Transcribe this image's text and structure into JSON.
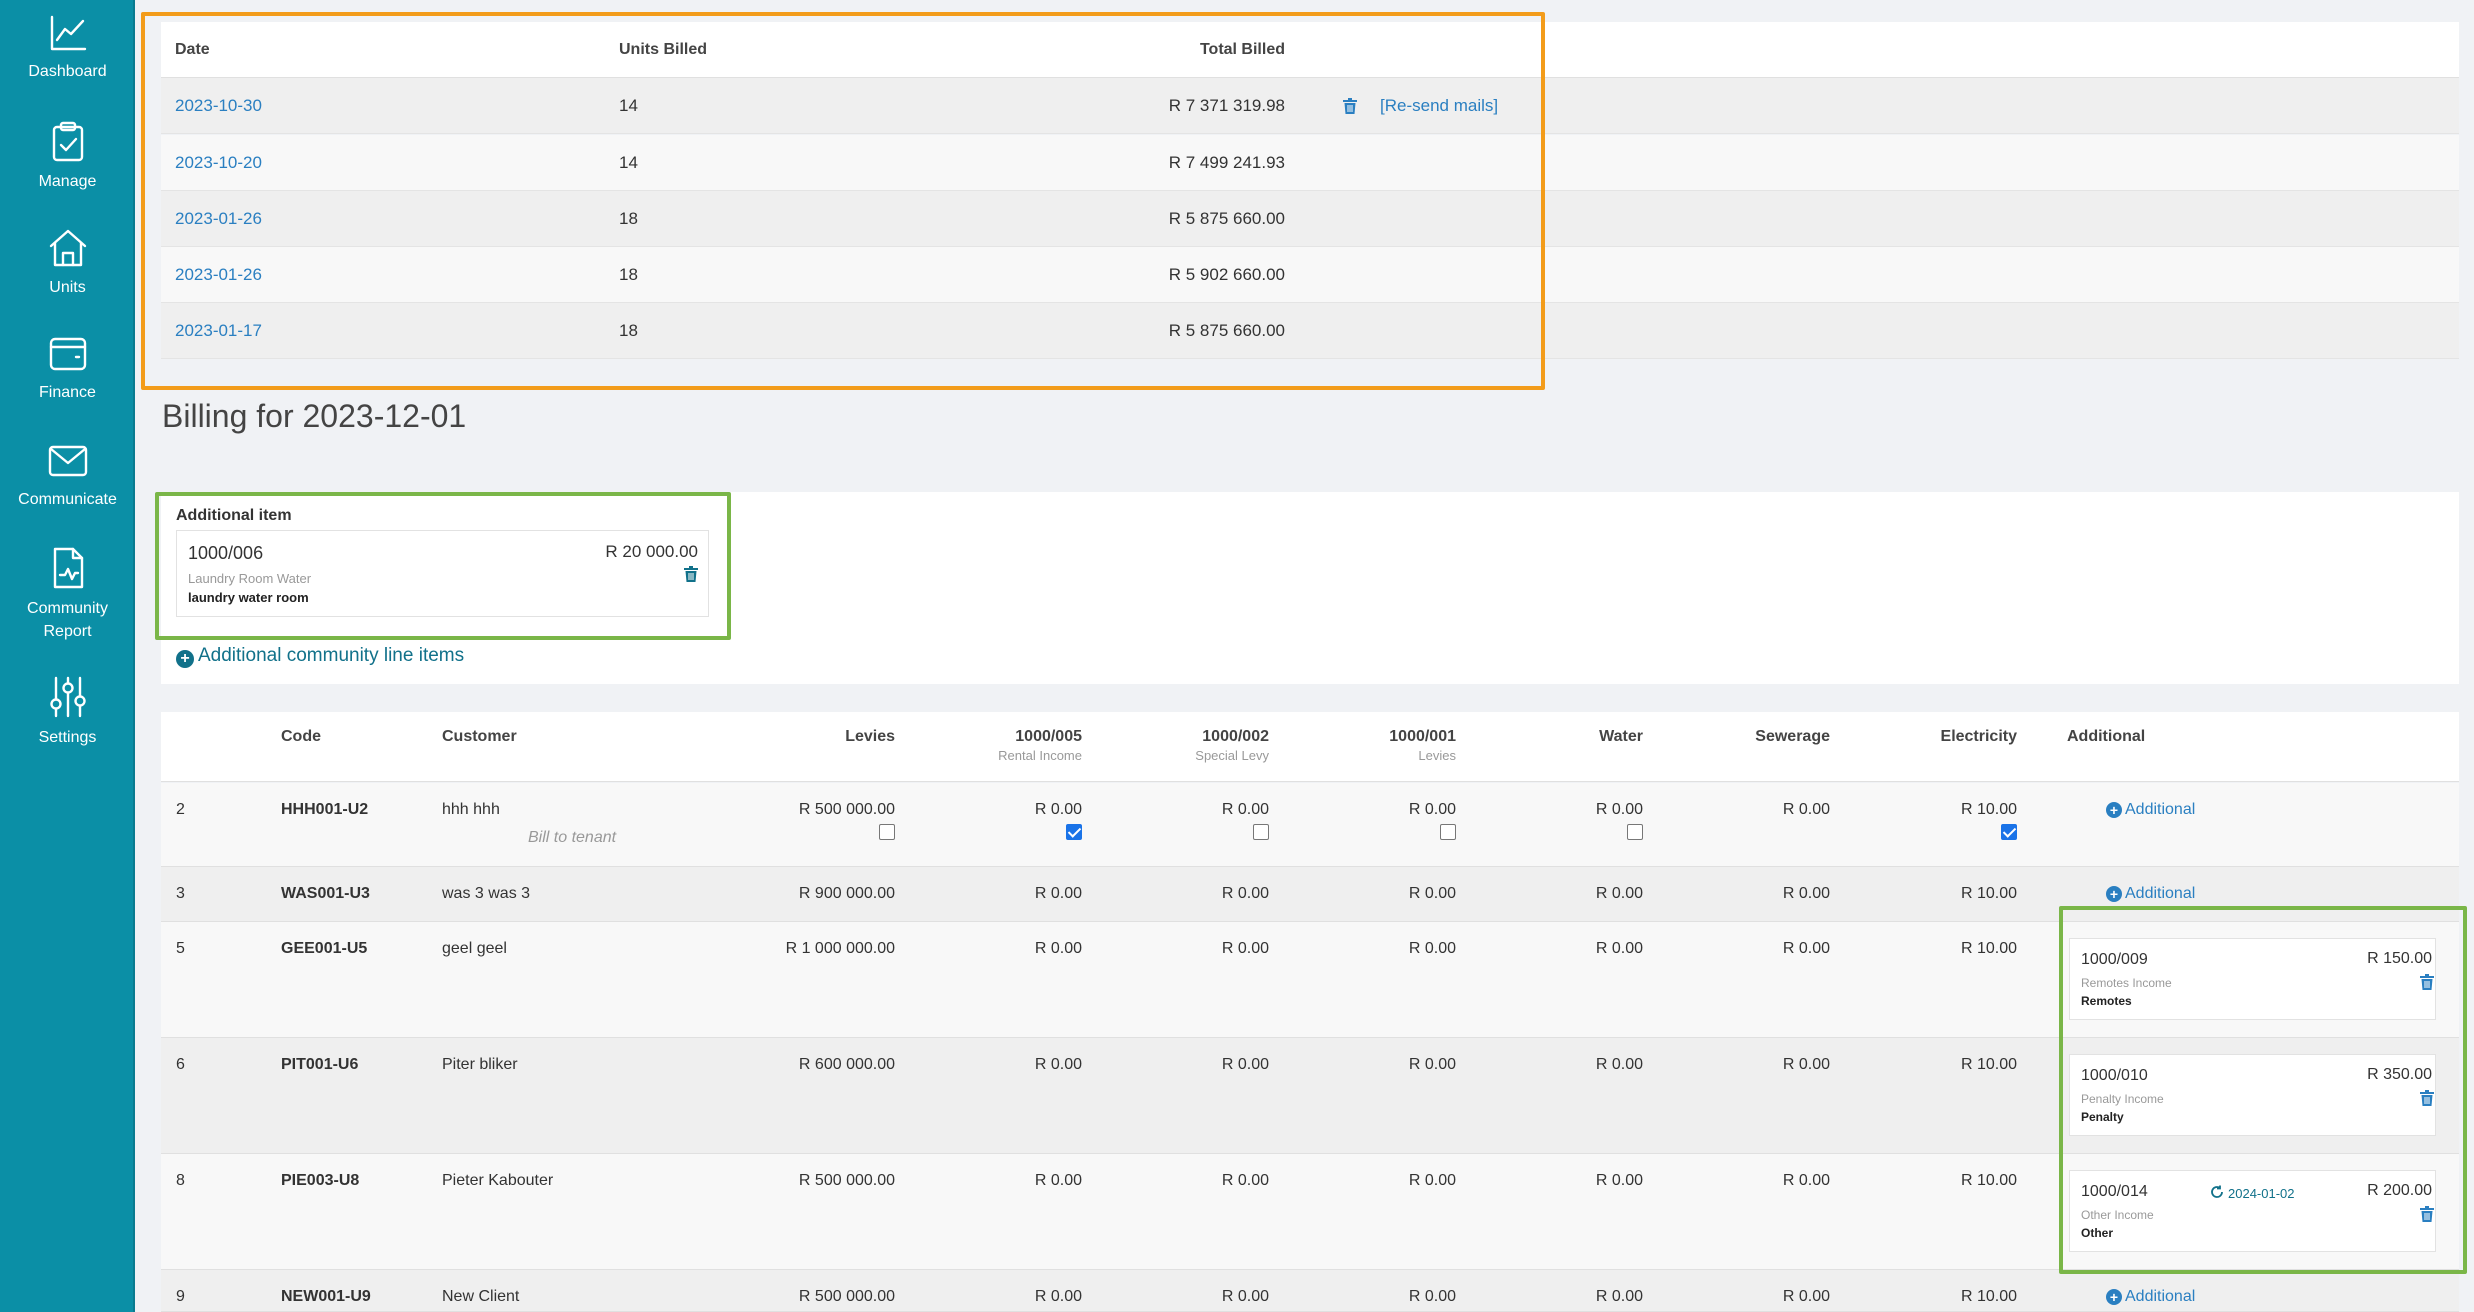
{
  "sidebar": {
    "items": [
      {
        "label": "Dashboard",
        "icon": "chart-line-icon"
      },
      {
        "label": "Manage",
        "icon": "clipboard-check-icon"
      },
      {
        "label": "Units",
        "icon": "home-icon"
      },
      {
        "label": "Finance",
        "icon": "wallet-icon"
      },
      {
        "label": "Communicate",
        "icon": "envelope-icon"
      },
      {
        "label": "Community Report",
        "icon": "report-icon"
      },
      {
        "label": "Settings",
        "icon": "sliders-icon"
      }
    ]
  },
  "history": {
    "headers": {
      "date": "Date",
      "units": "Units Billed",
      "total": "Total Billed"
    },
    "rows": [
      {
        "date": "2023-10-30",
        "units": "14",
        "total": "R 7 371 319.98",
        "resend": "[Re-send mails]"
      },
      {
        "date": "2023-10-20",
        "units": "14",
        "total": "R 7 499 241.93"
      },
      {
        "date": "2023-01-26",
        "units": "18",
        "total": "R 5 875 660.00"
      },
      {
        "date": "2023-01-26",
        "units": "18",
        "total": "R 5 902 660.00"
      },
      {
        "date": "2023-01-17",
        "units": "18",
        "total": "R 5 875 660.00"
      }
    ]
  },
  "billing": {
    "title": "Billing for 2023-12-01",
    "additional_item": {
      "heading": "Additional item",
      "code": "1000/006",
      "amount": "R 20 000.00",
      "account": "Laundry Room Water",
      "description": "laundry water room"
    },
    "add_community_link": "Additional community line items",
    "grid": {
      "headers": {
        "code": "Code",
        "customer": "Customer",
        "levies": "Levies",
        "c1000_005": "1000/005",
        "c1000_005_sub": "Rental Income",
        "c1000_002": "1000/002",
        "c1000_002_sub": "Special Levy",
        "c1000_001": "1000/001",
        "c1000_001_sub": "Levies",
        "water": "Water",
        "sewerage": "Sewerage",
        "electricity": "Electricity",
        "additional": "Additional"
      },
      "tenant_note": "Bill to tenant",
      "additional_button": "Additional",
      "rows": [
        {
          "num": "2",
          "code": "HHH001-U2",
          "customer": "hhh hhh",
          "levies": "R 500 000.00",
          "c005": "R 0.00",
          "c002": "R 0.00",
          "c001": "R 0.00",
          "water": "R 0.00",
          "sewerage": "R 0.00",
          "electricity": "R 10.00"
        },
        {
          "num": "3",
          "code": "WAS001-U3",
          "customer": "was 3 was 3",
          "levies": "R 900 000.00",
          "c005": "R 0.00",
          "c002": "R 0.00",
          "c001": "R 0.00",
          "water": "R 0.00",
          "sewerage": "R 0.00",
          "electricity": "R 10.00"
        },
        {
          "num": "5",
          "code": "GEE001-U5",
          "customer": "geel geel",
          "levies": "R 1 000 000.00",
          "c005": "R 0.00",
          "c002": "R 0.00",
          "c001": "R 0.00",
          "water": "R 0.00",
          "sewerage": "R 0.00",
          "electricity": "R 10.00",
          "extra": {
            "code": "1000/009",
            "amount": "R 150.00",
            "account": "Remotes Income",
            "description": "Remotes"
          }
        },
        {
          "num": "6",
          "code": "PIT001-U6",
          "customer": "Piter bliker",
          "levies": "R 600 000.00",
          "c005": "R 0.00",
          "c002": "R 0.00",
          "c001": "R 0.00",
          "water": "R 0.00",
          "sewerage": "R 0.00",
          "electricity": "R 10.00",
          "extra": {
            "code": "1000/010",
            "amount": "R 350.00",
            "account": "Penalty Income",
            "description": "Penalty"
          }
        },
        {
          "num": "8",
          "code": "PIE003-U8",
          "customer": "Pieter Kabouter",
          "levies": "R 500 000.00",
          "c005": "R 0.00",
          "c002": "R 0.00",
          "c001": "R 0.00",
          "water": "R 0.00",
          "sewerage": "R 0.00",
          "electricity": "R 10.00",
          "extra": {
            "code": "1000/014",
            "amount": "R 200.00",
            "account": "Other Income",
            "description": "Other",
            "recurring": "2024-01-02"
          }
        },
        {
          "num": "9",
          "code": "NEW001-U9",
          "customer": "New Client",
          "levies": "R 500 000.00",
          "c005": "R 0.00",
          "c002": "R 0.00",
          "c001": "R 0.00",
          "water": "R 0.00",
          "sewerage": "R 0.00",
          "electricity": "R 10.00"
        }
      ],
      "row1_checks": {
        "levies": false,
        "c005": true,
        "c002": false,
        "c001": false,
        "water": false,
        "electricity": true
      }
    }
  },
  "colors": {
    "sidebar": "#0b8fa6",
    "link": "#2a7fc1",
    "highlight_orange": "#f39c1a",
    "highlight_green": "#7ab648"
  }
}
